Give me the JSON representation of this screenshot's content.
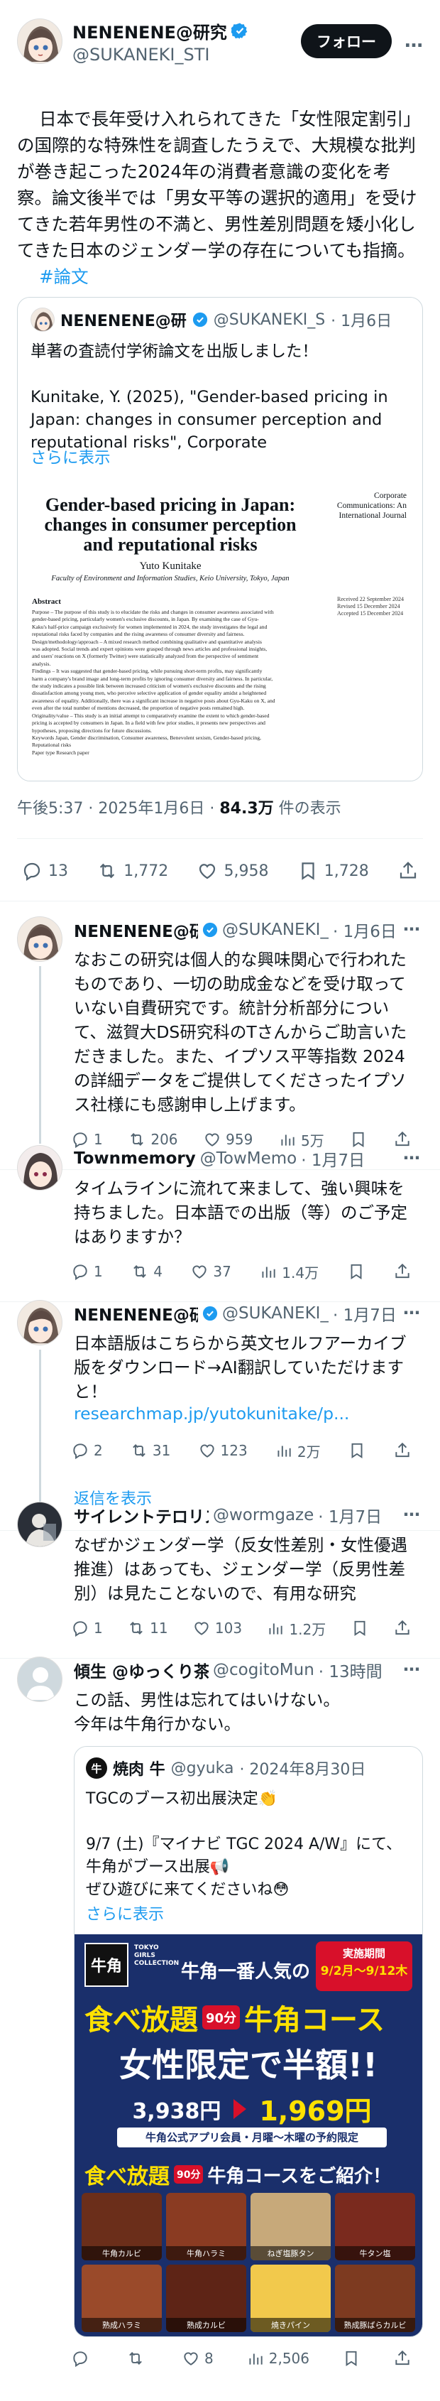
{
  "main_post": {
    "author_name": "NENENENE@研究",
    "author_handle": "@SUKANEKI_STI",
    "follow_label": "フォロー",
    "more_label": "…",
    "text_part1": "日本で長年受け入れられてきた「女性限定割引」の国際的な特殊性を調査したうえで、大規模な批判が巻き起こった2024年の消費者意識の変化を考察。論文後半では「男女平等の選択的適用」を受けてきた若年男性の不満と、男性差別問題を矮小化してきた日本のジェンダー学の存在についても指摘。",
    "hashtag": "#論文",
    "quoted": {
      "author_name": "NENENENE@研",
      "author_handle": "@SUKANEKI_S",
      "date": "· 1月6日",
      "text": "単著の査読付学術論文を出版しました！\n\nKunitake, Y. (2025), \"Gender-based pricing in Japan: changes in consumer perception and reputational risks\", Corporate",
      "show_more": "さらに表示",
      "paper": {
        "title": "Gender-based pricing in Japan: changes in consumer perception and reputational risks",
        "author": "Yuto Kunitake",
        "affiliation": "Faculty of Environment and Information Studies, Keio University, Tokyo, Japan",
        "journal": "Corporate Communications: An International Journal",
        "received": "Received 22 September 2024",
        "revised": "Revised 15 December 2024",
        "accepted": "Accepted 15 December 2024",
        "abstract_heading": "Abstract",
        "abstract_lines": [
          "Purpose – The purpose of this study is to elucidate the risks and changes in consumer awareness associated with",
          "gender-based pricing, particularly women's exclusive discounts, in Japan. By examining the case of Gyu-",
          "Kaku's half-price campaign exclusively for women implemented in 2024, the study investigates the legal and",
          "reputational risks faced by companies and the rising awareness of consumer diversity and fairness.",
          "Design/methodology/approach – A mixed research method combining qualitative and quantitative analysis",
          "was adopted. Social trends and expert opinions were grasped through news articles and professional insights,",
          "and users' reactions on X (formerly Twitter) were statistically analyzed from the perspective of sentiment",
          "analysis.",
          "Findings – It was suggested that gender-based pricing, while pursuing short-term profits, may significantly",
          "harm a company's brand image and long-term profits by ignoring consumer diversity and fairness. In particular,",
          "the study indicates a possible link between increased criticism of women's exclusive discounts and the rising",
          "dissatisfaction among young men, who perceive selective application of gender equality amidst a heightened",
          "awareness of equality. Additionally, there was a significant increase in negative posts about Gyu-Kaku on X, and",
          "even after the total number of mentions decreased, the proportion of negative posts remained high.",
          "Originality/value – This study is an initial attempt to comparatively examine the extent to which gender-based",
          "pricing is accepted by consumers in Japan. In a field with few prior studies, it presents new perspectives and",
          "hypotheses, proposing directions for future discussions.",
          "Keywords Japan, Gender discrimination, Consumer awareness, Benevolent sexism, Gender-based pricing,",
          "Reputational risks",
          "Paper type Research paper"
        ]
      }
    },
    "timestamp": "午後5:37 · 2025年1月6日 · ",
    "views_count": "84.3万",
    "views_label": " 件の表示",
    "stats": {
      "replies": "13",
      "reposts": "1,772",
      "likes": "5,958",
      "bookmarks": "1,728"
    }
  },
  "replies": [
    {
      "author_name": "NENENENE@研",
      "author_handle": "@SUKANEKI_",
      "date": "· 1月6日",
      "text": "なおこの研究は個人的な興味関心で行われたものであり、一切の助成金などを受け取っていない自費研究です。統計分析部分について、滋賀大DS研究科のTさんからご助言いただきました。また、イプソス平等指数 2024の詳細データをご提供してくださったイプソス社様にも感謝申し上げます。",
      "stats": {
        "replies": "1",
        "reposts": "206",
        "likes": "959",
        "views": "5万"
      }
    },
    {
      "author_name": "Townmemory",
      "author_handle": "@TowMemo",
      "date": "· 1月7日",
      "text": "タイムラインに流れて来まして、強い興味を持ちました。日本語での出版（等）のご予定はありますか？",
      "stats": {
        "replies": "1",
        "reposts": "4",
        "likes": "37",
        "views": "1.4万"
      }
    },
    {
      "author_name": "NENENENE@研",
      "author_handle": "@SUKANEKI_",
      "date": "· 1月7日",
      "text": "日本語版はこちらから英文セルフアーカイブ版をダウンロード→AI翻訳していただけますと！",
      "link": "researchmap.jp/yutokunitake/p...",
      "stats": {
        "replies": "2",
        "reposts": "31",
        "likes": "123",
        "views": "2万"
      },
      "show_replies": "返信を表示"
    },
    {
      "author_name": "サイレントテロリス",
      "author_handle": "@wormgaze",
      "date": "· 1月7日",
      "text": "なぜかジェンダー学（反女性差別・女性優遇推進）はあっても、ジェンダー学（反男性差別）は見たことないので、有用な研究",
      "stats": {
        "replies": "1",
        "reposts": "11",
        "likes": "103",
        "views": "1.2万"
      }
    },
    {
      "author_name": "傾生 @ゆっくり茶",
      "author_handle": "@cogitoMun",
      "date": "· 13時間",
      "text": "この話、男性は忘れてはいけない。\n今年は牛角行かない。",
      "quoted": {
        "author_name": "焼肉 牛",
        "author_handle": "@gyuka",
        "date": "· 2024年8月30日",
        "text": "TGCのブース初出展決定👏\n\n9/7 (土)『マイナビ TGC 2024 A/W』にて、牛角がブース出展📢\nぜひ遊びに来てくださいね😳",
        "show_more": "さらに表示",
        "banner": {
          "brand": "牛角",
          "tgc": "TOKYO GIRLS COLLECTION",
          "event_label": "実施期間",
          "event_dates": "9/2月〜9/12木",
          "headline1": "牛角一番人気の",
          "headline2": "食べ放題",
          "min_label": "90分",
          "headline3": "牛角コース",
          "headline4": "女性限定で半額!!",
          "price_before": "3,938円",
          "price_after": "1,969円",
          "note": "牛角公式アプリ会員・月曜〜木曜の予約限定",
          "headline5": "食べ放題",
          "headline6": "牛角コースをご紹介！",
          "dishes": [
            "牛角カルビ",
            "牛角ハラミ",
            "ねぎ塩豚タン",
            "牛タン塩",
            "熟成ハラミ",
            "熟成カルビ",
            "焼きパイン",
            "熟成豚ばらカルビ"
          ]
        }
      },
      "stats": {
        "replies": "",
        "reposts": "",
        "likes": "8",
        "views": "2,506"
      }
    }
  ],
  "colors": {
    "link": "#1d9bf0",
    "muted": "#536471",
    "verified": "#1d9bf0",
    "border": "#cfd9de",
    "banner_navy": "#1a2f6b",
    "banner_red": "#d8102a",
    "banner_yellow": "#ffe100"
  },
  "icons": [
    "verified-badge-icon",
    "more-icon",
    "reply-icon",
    "repost-icon",
    "like-icon",
    "bookmark-icon",
    "share-icon",
    "views-icon",
    "tgc-icon",
    "clap-emoji",
    "megaphone-emoji",
    "face-emoji"
  ]
}
